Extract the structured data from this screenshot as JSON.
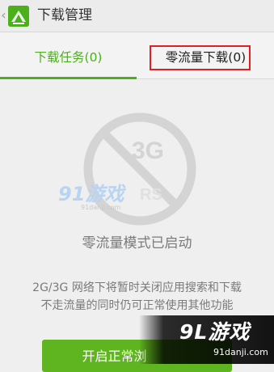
{
  "header": {
    "title": "下载管理"
  },
  "tabs": [
    {
      "label": "下载任务(0)"
    },
    {
      "label": "零流量下载(0)"
    }
  ],
  "illustration": {
    "badge_text": "3G"
  },
  "status": {
    "title": "零流量模式已启动",
    "line1": "2G/3G 网络下将暂时关闭应用搜索和下载",
    "line2": "不走流量的同时仍可正常使用其他功能"
  },
  "button": {
    "label": "开启正常浏"
  },
  "watermark": {
    "center_logo": "91游戏",
    "center_url": "91danji.com",
    "corner_logo": "9L游戏",
    "corner_url": "91danji.com"
  },
  "colors": {
    "accent": "#4caf1c",
    "highlight": "#e02020"
  }
}
